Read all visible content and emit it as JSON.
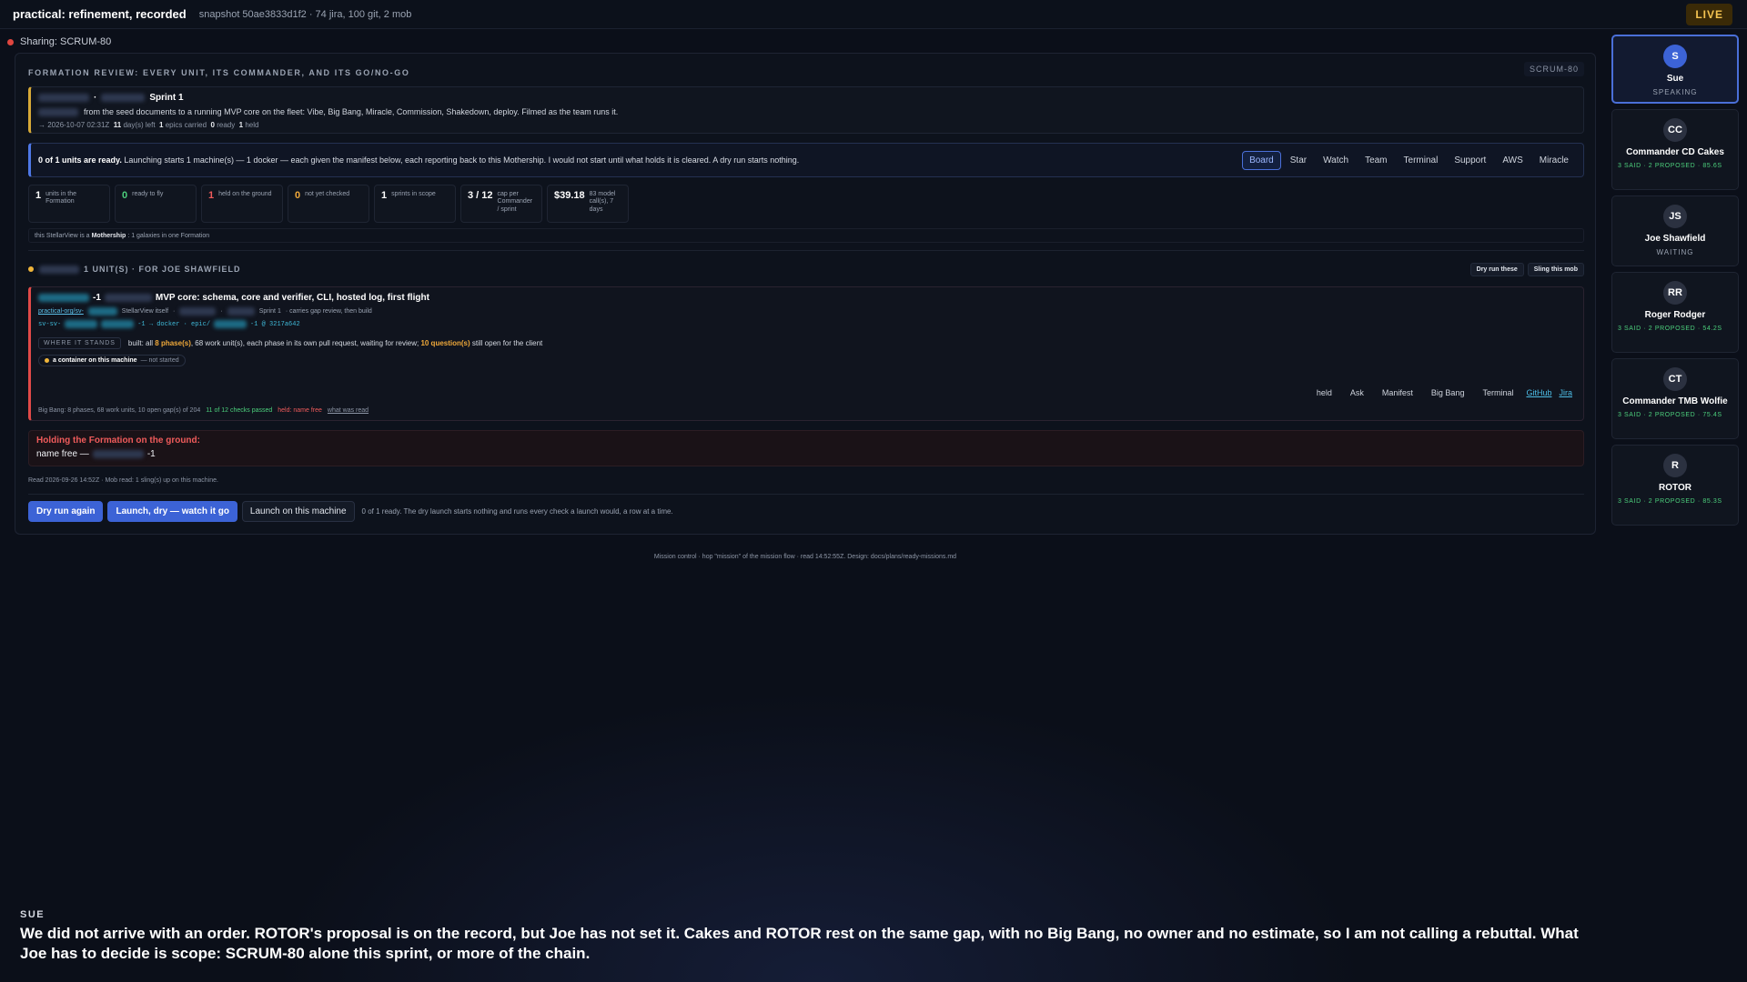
{
  "topbar": {
    "title": "practical: refinement, recorded",
    "snapshot": "snapshot 50ae3833d1f2 · 74 jira, 100 git, 2 mob",
    "live": "LIVE"
  },
  "sharing": "Sharing: SCRUM-80",
  "stage": {
    "tag": "SCRUM-80",
    "heading": "FORMATION REVIEW: EVERY UNIT, ITS COMMANDER, AND ITS GO/NO-GO",
    "sprint": {
      "title": "Sprint 1",
      "desc": "from the seed documents to a running MVP core on the fleet: Vibe, Big Bang, Miracle, Commission, Shakedown, deploy. Filmed as the team runs it.",
      "meta_date": "→ 2026-10-07 02:31Z",
      "meta_days": "11",
      "meta_days_lbl": "day(s) left",
      "meta_epics": "1",
      "meta_epics_lbl": "epics carried",
      "meta_ready": "0",
      "meta_ready_lbl": "ready",
      "meta_held": "1",
      "meta_held_lbl": "held"
    },
    "readiness": {
      "bold": "0 of 1 units are ready.",
      "rest": " Launching starts 1 machine(s) — 1 docker — each given the manifest below, each reporting back to this Mothership. I would not start until what holds it is cleared. A dry run starts nothing."
    },
    "tabs": [
      "Board",
      "Star",
      "Watch",
      "Team",
      "Terminal",
      "Support",
      "AWS",
      "Miracle"
    ],
    "stats": [
      {
        "num": "1",
        "label": "units in the Formation",
        "color": "white"
      },
      {
        "num": "0",
        "label": "ready to fly",
        "color": "green"
      },
      {
        "num": "1",
        "label": "held on the ground",
        "color": "red"
      },
      {
        "num": "0",
        "label": "not yet checked",
        "color": "orange"
      },
      {
        "num": "1",
        "label": "sprints in scope",
        "color": "white"
      },
      {
        "num": "3 / 12",
        "label": "cap per Commander / sprint",
        "color": "white"
      },
      {
        "num": "$39.18",
        "label": "83 model call(s), 7 days",
        "color": "white"
      }
    ],
    "mothership": {
      "pre": "this StellarView is a",
      "bold": "Mothership",
      "post": ": 1 galaxies in one Formation"
    },
    "group": {
      "label": "1 UNIT(S) · FOR JOE SHAWFIELD",
      "dry_run": "Dry run these",
      "sling": "Sling this mob"
    },
    "unit": {
      "suffix": "-1",
      "title": "MVP core: schema, core and verifier, CLI, hosted log, first flight",
      "repo_link": "practical-org/sv-",
      "itself": "StellarView itself",
      "sprint": "Sprint 1",
      "carries": "· carries gap review, then build",
      "branch_pre": "sv-sv-",
      "branch_mid": "-1 → docker · epic/",
      "branch_post": "-1 @ 3217a642",
      "stands_chip": "WHERE IT STANDS",
      "stands_pre": "built: all",
      "stands_phases": "8 phase(s)",
      "stands_mid": ", 68 work unit(s), each phase in its own pull request, waiting for review;",
      "stands_questions": "10 question(s)",
      "stands_post": "still open for the client",
      "container_bold": "a container on this machine",
      "container_status": "— not started",
      "links": [
        "held",
        "Ask",
        "Manifest",
        "Big Bang",
        "Terminal"
      ],
      "ext_links": [
        "GitHub",
        "Jira"
      ],
      "foot_main": "Big Bang: 8 phases, 68 work units, 10 open gap(s) of 204",
      "foot_checks": "11 of 12 checks passed",
      "foot_held": "held: name free",
      "foot_read": "what was read"
    },
    "holding": {
      "heading": "Holding the Formation on the ground:",
      "value_pre": "name free —",
      "value_post": "-1"
    },
    "readline": "Read 2026-09-26 14:52Z · Mob read: 1 sling(s) up on this machine.",
    "launch": {
      "dry_again": "Dry run again",
      "launch_dry": "Launch, dry — watch it go",
      "launch_machine": "Launch on this machine",
      "note": "0 of 1 ready. The dry launch starts nothing and runs every check a launch would, a row at a time."
    }
  },
  "footer_note": "Mission control · hop \"mission\" of the mission flow · read 14:52:55Z. Design: docs/plans/ready-missions.md",
  "roster": [
    {
      "initials": "S",
      "name": "Sue",
      "status": "SPEAKING",
      "stats": "",
      "speaking": true
    },
    {
      "initials": "CC",
      "name": "Commander CD Cakes",
      "status": "",
      "stats": "3 SAID · 2 PROPOSED · 85.6S",
      "speaking": false
    },
    {
      "initials": "JS",
      "name": "Joe Shawfield",
      "status": "WAITING",
      "stats": "",
      "speaking": false
    },
    {
      "initials": "RR",
      "name": "Roger Rodger",
      "status": "",
      "stats": "3 SAID · 2 PROPOSED · 54.2S",
      "speaking": false
    },
    {
      "initials": "CT",
      "name": "Commander TMB Wolfie",
      "status": "",
      "stats": "3 SAID · 2 PROPOSED · 75.4S",
      "speaking": false
    },
    {
      "initials": "R",
      "name": "ROTOR",
      "status": "",
      "stats": "3 SAID · 2 PROPOSED · 85.3S",
      "speaking": false
    }
  ],
  "caption": {
    "speaker": "SUE",
    "text": "We did not arrive with an order. ROTOR's proposal is on the record, but Joe has not set it. Cakes and ROTOR rest on the same gap, with no Big Bang, no owner and no estimate, so I am not calling a rebuttal. What Joe has to decide is scope: SCRUM-80 alone this sprint, or more of the chain."
  }
}
